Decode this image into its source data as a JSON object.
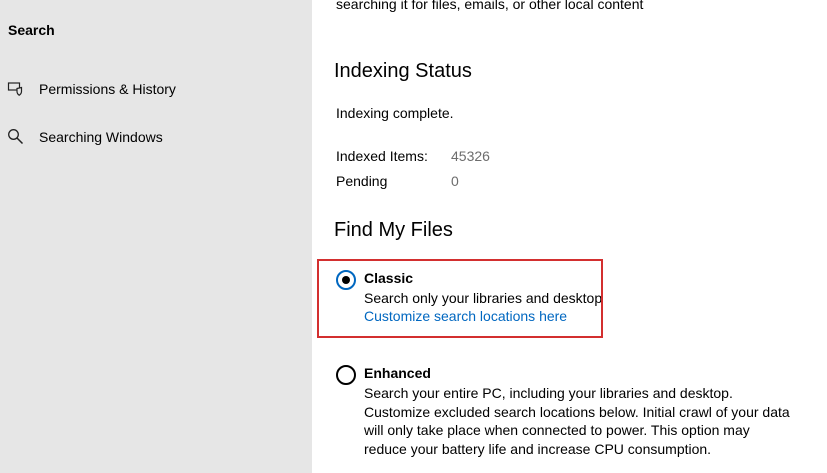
{
  "sidebar": {
    "header": "Search",
    "items": [
      {
        "label": "Permissions & History",
        "icon": "shield-search-icon"
      },
      {
        "label": "Searching Windows",
        "icon": "search-icon"
      }
    ]
  },
  "main": {
    "intro_cut": "searching it for files, emails, or other local content",
    "indexing": {
      "title": "Indexing Status",
      "status": "Indexing complete.",
      "indexed_label": "Indexed Items:",
      "indexed_value": "45326",
      "pending_label": "Pending",
      "pending_value": "0"
    },
    "find_files": {
      "title": "Find My Files",
      "classic": {
        "title": "Classic",
        "description": "Search only your libraries and desktop",
        "link": "Customize search locations here",
        "selected": true
      },
      "enhanced": {
        "title": "Enhanced",
        "description": "Search your entire PC, including your libraries and desktop. Customize excluded search locations below. Initial crawl of your data will only take place when connected to power. This option may reduce your battery life and increase CPU consumption.",
        "selected": false
      }
    }
  },
  "colors": {
    "sidebar_bg": "#e6e6e6",
    "link": "#0067c0",
    "highlight": "#d32f2f",
    "muted_value": "#6d6d6d"
  }
}
